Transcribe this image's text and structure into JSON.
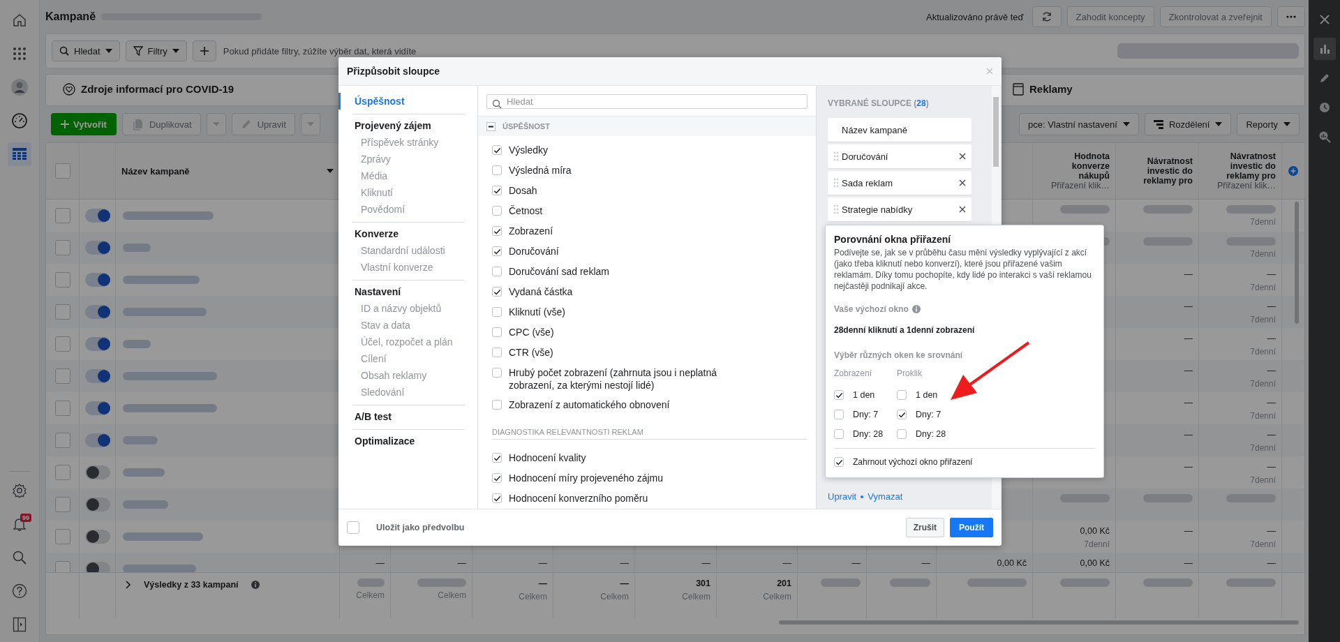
{
  "nav_rail": {
    "top": [
      {
        "kind": "home",
        "selected": false
      },
      {
        "kind": "apps",
        "selected": false
      },
      {
        "kind": "avatar",
        "selected": false
      },
      {
        "kind": "gauge",
        "selected": false
      },
      {
        "kind": "table",
        "selected": true
      }
    ],
    "bottom": [
      {
        "kind": "settings",
        "selected": false
      },
      {
        "kind": "bell",
        "selected": false,
        "badge": "99"
      },
      {
        "kind": "search",
        "selected": false
      },
      {
        "kind": "help",
        "selected": false
      },
      {
        "kind": "panel",
        "selected": false
      }
    ]
  },
  "side_rail": {
    "items": [
      {
        "kind": "close",
        "selected": false
      },
      {
        "kind": "chart",
        "selected": true
      },
      {
        "kind": "edit",
        "selected": false
      },
      {
        "kind": "clock",
        "selected": false
      },
      {
        "kind": "inspect",
        "selected": false
      }
    ]
  },
  "header": {
    "title": "Kampaně",
    "status": "Aktualizováno právě teď",
    "buttons": [
      {
        "label": "Zahodit koncepty",
        "disabled": true
      },
      {
        "label": "Zkontrolovat a zveřejnit",
        "disabled": true
      }
    ]
  },
  "filter_bar": {
    "buttons": [
      {
        "label": "Hledat",
        "kind": "search"
      },
      {
        "label": "Filtry",
        "kind": "filter"
      }
    ],
    "placeholder": "Pokud přidáte filtry, zúžíte výběr dat, která vidíte"
  },
  "tabs": [
    {
      "label": "Zdroje informací pro COVID-19",
      "kind": "covid",
      "selected": false
    },
    {
      "label": "Reklamy",
      "kind": "ads",
      "selected": false
    }
  ],
  "toolbar": {
    "create": "Vytvořit",
    "left": [
      {
        "label": "Duplikovat",
        "kind": "copy",
        "disabled": true
      },
      {
        "label": "Upravit",
        "kind": "edit",
        "disabled": true
      }
    ],
    "right": [
      {
        "label": "pce: Vlastní nastavení",
        "kind": "plain"
      },
      {
        "label": "Rozdělení",
        "kind": "breakdown"
      },
      {
        "label": "Reporty",
        "kind": "plain"
      }
    ]
  },
  "table": {
    "all_selected": false,
    "name_header": "Název kampaně",
    "columns": [
      null,
      null,
      null,
      null,
      null,
      null,
      null,
      null,
      null,
      {
        "title": "Hodnota konverze nákupů",
        "sub": "Přiřazení klik…"
      },
      {
        "title": "Návratnost investic do reklamy pro"
      },
      {
        "title": "Návratnost investic do reklamy pro",
        "sub": "Přiřazení klik…"
      }
    ],
    "rows": [
      {
        "selected": false,
        "on": true,
        "cells": [
          null,
          null,
          null,
          null,
          null,
          null,
          null,
          null,
          null,
          {
            "blurred": true
          },
          {
            "blurred": true
          },
          {
            "blurred": true,
            "sub": "7denní"
          }
        ]
      },
      {
        "selected": false,
        "on": true,
        "cells": [
          null,
          null,
          null,
          null,
          null,
          null,
          null,
          null,
          null,
          {
            "blurred": true
          },
          {
            "blurred": true
          },
          {
            "blurred": true,
            "sub": "7denní"
          }
        ]
      },
      {
        "selected": false,
        "on": true,
        "cells": [
          null,
          null,
          null,
          null,
          null,
          null,
          null,
          null,
          null,
          null,
          {
            "text": "—"
          },
          {
            "text": "—",
            "sub": "7denní"
          }
        ]
      },
      {
        "selected": false,
        "on": true,
        "cells": [
          null,
          null,
          null,
          null,
          null,
          null,
          null,
          null,
          null,
          null,
          {
            "text": "—"
          },
          {
            "text": "—",
            "sub": "7denní"
          }
        ]
      },
      {
        "selected": false,
        "on": true,
        "cells": [
          null,
          null,
          null,
          null,
          null,
          null,
          null,
          null,
          null,
          null,
          {
            "text": "—"
          },
          {
            "text": "—",
            "sub": "7denní"
          }
        ]
      },
      {
        "selected": false,
        "on": true,
        "cells": [
          null,
          null,
          null,
          null,
          null,
          null,
          null,
          null,
          null,
          null,
          {
            "text": "—"
          },
          {
            "text": "—",
            "sub": "7denní"
          }
        ]
      },
      {
        "selected": false,
        "on": true,
        "cells": [
          null,
          null,
          null,
          null,
          null,
          null,
          null,
          null,
          null,
          null,
          {
            "text": "—"
          },
          {
            "text": "—",
            "sub": "7denní"
          }
        ]
      },
      {
        "selected": false,
        "on": true,
        "cells": [
          null,
          null,
          null,
          null,
          null,
          null,
          null,
          null,
          null,
          null,
          {
            "text": "—"
          },
          {
            "text": "—",
            "sub": "7denní"
          }
        ]
      },
      {
        "selected": false,
        "on": false,
        "cells": [
          null,
          null,
          null,
          null,
          null,
          null,
          null,
          null,
          null,
          null,
          {
            "text": "—"
          },
          {
            "text": "—",
            "sub": "7denní"
          }
        ]
      },
      {
        "selected": false,
        "on": false,
        "cells": [
          null,
          null,
          null,
          null,
          null,
          null,
          null,
          null,
          null,
          {
            "blurred": true
          },
          {
            "blurred": true
          },
          {
            "blurred": true
          }
        ]
      },
      {
        "selected": false,
        "on": false,
        "cells": [
          null,
          null,
          null,
          null,
          null,
          null,
          null,
          null,
          null,
          {
            "text": "0,00 Kč",
            "sub": "7denní"
          },
          {
            "text": "—"
          },
          {
            "text": "—",
            "sub": "7denní"
          }
        ]
      },
      {
        "selected": false,
        "on": false,
        "cells": [
          {
            "text": "—"
          },
          {
            "text": "—"
          },
          {
            "text": "—"
          },
          {
            "text": "—"
          },
          {
            "text": "—"
          },
          {
            "text": "—"
          },
          {
            "text": "—"
          },
          {
            "text": "—"
          },
          {
            "text": "0,00 Kč"
          },
          {
            "text": "0,00 Kč"
          },
          {
            "text": "—"
          },
          {
            "text": "—"
          }
        ]
      }
    ],
    "footer": {
      "label": "Výsledky z 33 kampaní",
      "cells": [
        {
          "blurred": true,
          "sub": "Celkem"
        },
        {
          "blurred": true,
          "sub": "Celkem"
        },
        {
          "text": "—",
          "sub": "Celkem"
        },
        {
          "text": "—",
          "sub": "Celkem"
        },
        {
          "text": "301",
          "sub": "Celkem"
        },
        {
          "text": "201",
          "sub": "Celkem"
        },
        {
          "blurred": true
        },
        {
          "blurred": true
        },
        {
          "blurred": true
        },
        {
          "blurred": true
        },
        {
          "blurred": true
        },
        {
          "blurred": true
        }
      ]
    }
  },
  "dialog": {
    "title": "Přizpůsobit sloupce",
    "nav": [
      {
        "label": "Úspěšnost",
        "selected": true
      },
      {
        "label": "Projevený zájem",
        "selected": false,
        "items": [
          "Příspěvek stránky",
          "Zprávy",
          "Média",
          "Kliknutí",
          "Povědomí"
        ]
      },
      {
        "label": "Konverze",
        "selected": false,
        "items": [
          "Standardní události",
          "Vlastní konverze"
        ]
      },
      {
        "label": "Nastavení",
        "selected": false,
        "items": [
          "ID a názvy objektů",
          "Stav a data",
          "Účel, rozpočet a plán",
          "Cílení",
          "Obsah reklamy",
          "Sledování"
        ]
      },
      {
        "label": "A/B test",
        "selected": false
      },
      {
        "label": "Optimalizace",
        "selected": false
      }
    ],
    "search_placeholder": "Hledat",
    "sections": [
      {
        "title": "ÚSPĚŠNOST",
        "kind": "collapsible",
        "options": [
          {
            "label": "Výsledky",
            "checked": true
          },
          {
            "label": "Výsledná míra",
            "checked": false
          },
          {
            "label": "Dosah",
            "checked": true
          },
          {
            "label": "Četnost",
            "checked": false
          },
          {
            "label": "Zobrazení",
            "checked": true
          },
          {
            "label": "Doručování",
            "checked": true
          },
          {
            "label": "Doručování sad reklam",
            "checked": false
          },
          {
            "label": "Vydaná částka",
            "checked": true
          },
          {
            "label": "Kliknutí (vše)",
            "checked": false
          },
          {
            "label": "CPC (vše)",
            "checked": false
          },
          {
            "label": "CTR (vše)",
            "checked": false
          },
          {
            "label": "Hrubý počet zobrazení (zahrnuta jsou i neplatná zobrazení, za kterými nestojí lidé)",
            "checked": false
          },
          {
            "label": "Zobrazení z automatického obnovení",
            "checked": false
          }
        ]
      },
      {
        "title": "DIAGNOSTIKA RELEVANTNOSTI REKLAM",
        "kind": "plain",
        "options": [
          {
            "label": "Hodnocení kvality",
            "checked": true
          },
          {
            "label": "Hodnocení míry projeveného zájmu",
            "checked": true
          },
          {
            "label": "Hodnocení konverzního poměru",
            "checked": true
          }
        ]
      }
    ],
    "selected_columns": {
      "title": "VYBRANÉ SLOUPCE (**28**)",
      "items": [
        {
          "label": "Název kampaně",
          "removable": false
        },
        {
          "label": "Doručování",
          "removable": true
        },
        {
          "label": "Sada reklam",
          "removable": true
        },
        {
          "label": "Strategie nabídky",
          "removable": true
        }
      ],
      "links": [
        "Upravit",
        "Vymazat"
      ]
    },
    "save_preset": {
      "label": "Uložit jako předvolbu",
      "checked": false
    },
    "buttons": [
      {
        "label": "Zrušit",
        "kind": "secondary"
      },
      {
        "label": "Použít",
        "kind": "primary"
      }
    ]
  },
  "popover": {
    "title": "Porovnání okna přiřazení",
    "description": "Podívejte se, jak se v průběhu času mění výsledky vyplývající z akcí (jako třeba kliknutí nebo konverzí), které jsou přiřazené vašim reklamám. Díky tomu pochopíte, kdy lidé po interakci s vaší reklamou nejčastěji podnikají akce.",
    "default_label": "Vaše výchozí okno",
    "default_value": "28denní kliknutí a 1denní zobrazení",
    "compare_label": "Výběr různých oken ke srovnání",
    "groups": [
      {
        "title": "Zobrazení",
        "options": [
          {
            "label": "1 den",
            "checked": true
          },
          {
            "label": "Dny: 7",
            "checked": false
          },
          {
            "label": "Dny: 28",
            "checked": false
          }
        ]
      },
      {
        "title": "Proklik",
        "options": [
          {
            "label": "1 den",
            "checked": false
          },
          {
            "label": "Dny: 7",
            "checked": true
          },
          {
            "label": "Dny: 28",
            "checked": false
          }
        ]
      }
    ],
    "include_default": {
      "label": "Zahrnout výchozí okno přiřazení",
      "checked": true
    }
  }
}
